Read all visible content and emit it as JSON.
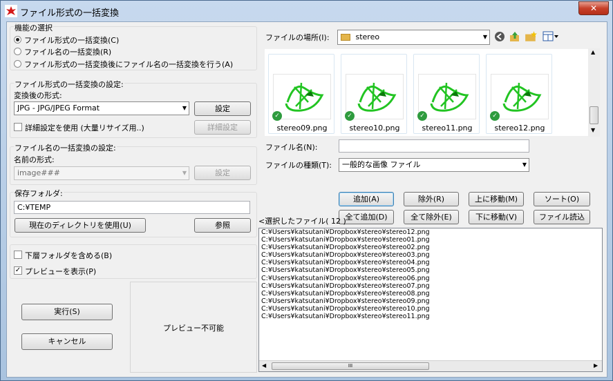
{
  "window": {
    "title": "ファイル形式の一括変換",
    "close_label": "✕"
  },
  "function_select": {
    "legend": "機能の選択",
    "options": [
      {
        "label": "ファイル形式の一括変換(C)",
        "selected": true
      },
      {
        "label": "ファイル名の一括変換(R)",
        "selected": false
      },
      {
        "label": "ファイル形式の一括変換後にファイル名の一括変換を行う(A)",
        "selected": false
      }
    ]
  },
  "format_settings": {
    "legend": "ファイル形式の一括変換の設定:",
    "format_label": "変換後の形式:",
    "format_value": "JPG - JPG/JPEG Format",
    "settings_button": "設定",
    "detail_checkbox_label": "詳細設定を使用 (大量リサイズ用..)",
    "detail_checked": false,
    "detail_button": "詳細設定"
  },
  "name_settings": {
    "legend": "ファイル名の一括変換の設定:",
    "name_label": "名前の形式:",
    "name_value": "image###",
    "settings_button": "設定"
  },
  "save_folder": {
    "legend": "保存フォルダ:",
    "path": "C:¥TEMP",
    "use_current_button": "現在のディレクトリを使用(U)",
    "browse_button": "参照"
  },
  "options": {
    "subfolder_label": "下層フォルダを含める(B)",
    "subfolder_checked": false,
    "preview_label": "プレビューを表示(P)",
    "preview_checked": true
  },
  "actions": {
    "run_button": "実行(S)",
    "cancel_button": "キャンセル"
  },
  "preview": {
    "text": "プレビュー不可能"
  },
  "browser": {
    "location_label": "ファイルの場所(I):",
    "location_value": "stereo",
    "thumbnails": [
      "stereo09.png",
      "stereo10.png",
      "stereo11.png",
      "stereo12.png"
    ],
    "filename_label": "ファイル名(N):",
    "filename_value": "",
    "filetype_label": "ファイルの種類(T):",
    "filetype_value": "一般的な画像 ファイル"
  },
  "list_buttons": {
    "add": "追加(A)",
    "remove": "除外(R)",
    "move_up": "上に移動(M)",
    "sort": "ソート(O)",
    "add_all": "全て追加(D)",
    "remove_all": "全て除外(E)",
    "move_down": "下に移動(V)",
    "load_file": "ファイル読込"
  },
  "selected": {
    "label": "<選択したファイル( 12 )",
    "files": [
      "C:¥Users¥katsutani¥Dropbox¥stereo¥stereo12.png",
      "C:¥Users¥katsutani¥Dropbox¥stereo¥stereo01.png",
      "C:¥Users¥katsutani¥Dropbox¥stereo¥stereo02.png",
      "C:¥Users¥katsutani¥Dropbox¥stereo¥stereo03.png",
      "C:¥Users¥katsutani¥Dropbox¥stereo¥stereo04.png",
      "C:¥Users¥katsutani¥Dropbox¥stereo¥stereo05.png",
      "C:¥Users¥katsutani¥Dropbox¥stereo¥stereo06.png",
      "C:¥Users¥katsutani¥Dropbox¥stereo¥stereo07.png",
      "C:¥Users¥katsutani¥Dropbox¥stereo¥stereo08.png",
      "C:¥Users¥katsutani¥Dropbox¥stereo¥stereo09.png",
      "C:¥Users¥katsutani¥Dropbox¥stereo¥stereo10.png",
      "C:¥Users¥katsutani¥Dropbox¥stereo¥stereo11.png"
    ],
    "scroll_grip": "III"
  },
  "colors": {
    "accent": "#3c7fb1",
    "thumb_green": "#22c422",
    "check_green": "#2e9b3e",
    "close_red": "#c7412b"
  }
}
